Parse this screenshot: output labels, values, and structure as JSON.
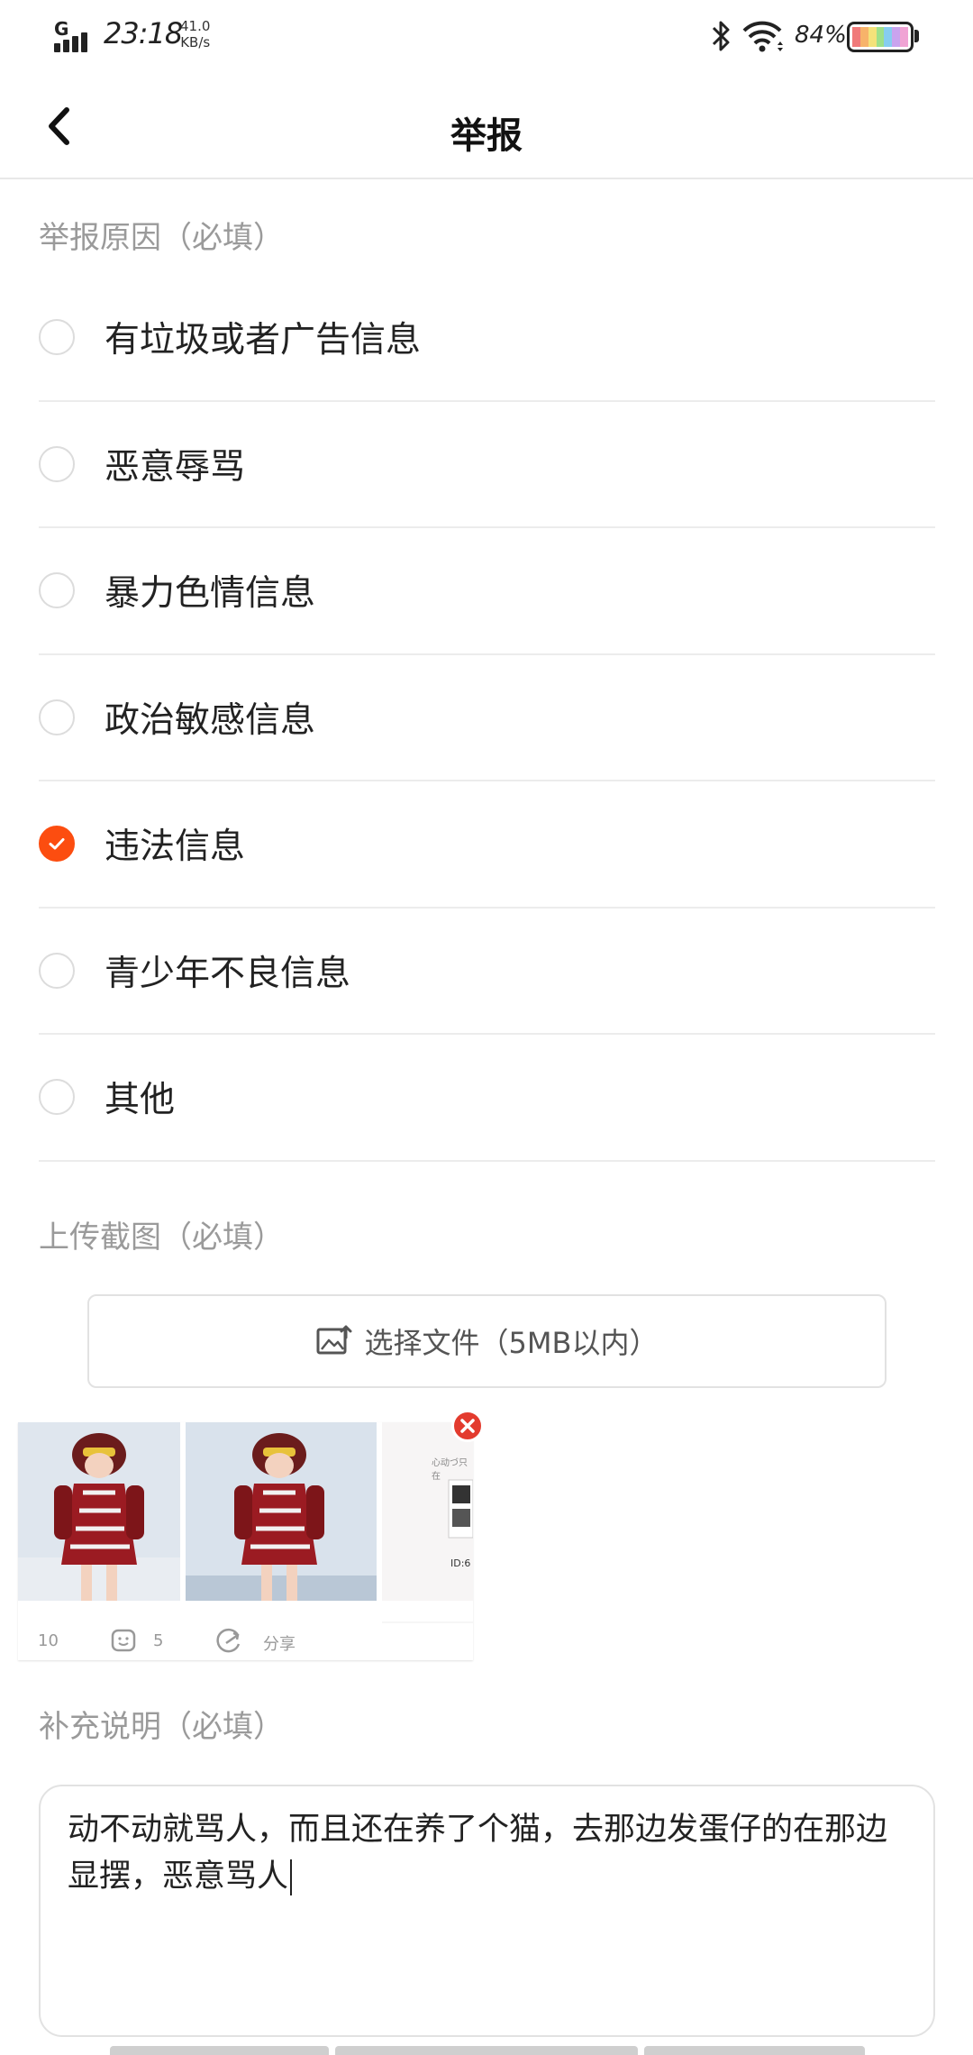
{
  "status_bar": {
    "network_type": "G",
    "time": "23:18",
    "net_speed_value": "41.0",
    "net_speed_unit": "KB/s",
    "battery_percent": "84%"
  },
  "header": {
    "title": "举报"
  },
  "reasons": {
    "label": "举报原因（必填）",
    "items": [
      {
        "label": "有垃圾或者广告信息",
        "checked": false
      },
      {
        "label": "恶意辱骂",
        "checked": false
      },
      {
        "label": "暴力色情信息",
        "checked": false
      },
      {
        "label": "政治敏感信息",
        "checked": false
      },
      {
        "label": "违法信息",
        "checked": true
      },
      {
        "label": "青少年不良信息",
        "checked": false
      },
      {
        "label": "其他",
        "checked": false
      }
    ]
  },
  "upload": {
    "label": "上传截图（必填）",
    "button_label": "选择文件（5MB以内）",
    "thumbnail": {
      "like_count": "10",
      "comment_count": "5",
      "share_label": "分享",
      "side_text": "心动づ只在",
      "id_text": "ID:6"
    }
  },
  "description": {
    "label": "补充说明（必填）",
    "value": "动不动就骂人，而且还在养了个猫，去那边发蛋仔的在那边显摆，恶意骂人"
  },
  "colors": {
    "accent": "#fc4d10",
    "remove": "#e33b2e",
    "muted_text": "#9a9a9a",
    "divider": "#ececec"
  }
}
